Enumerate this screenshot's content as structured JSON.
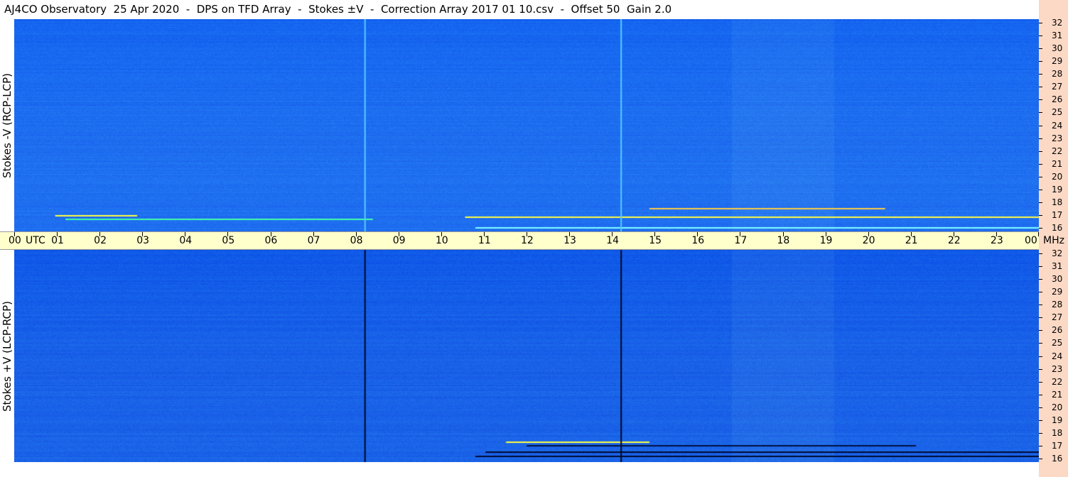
{
  "window": {
    "title": "AJ4CO Observatory  25 Apr 2020  -  DPS on TFD Array  -  Stokes ±V  -  Correction Array 2017 01 10.csv  -  Offset 50  Gain 2.0"
  },
  "chart_data": [
    {
      "type": "heatmap",
      "title": "",
      "xlabel": "UTC",
      "ylabel": "Stokes -V (RCP-LCP)",
      "x_tick_labels": [
        "00",
        "01",
        "02",
        "03",
        "04",
        "05",
        "06",
        "07",
        "08",
        "09",
        "10",
        "11",
        "12",
        "13",
        "14",
        "15",
        "16",
        "17",
        "18",
        "19",
        "20",
        "21",
        "22",
        "23",
        "00"
      ],
      "y_tick_labels": [
        "16",
        "17",
        "18",
        "19",
        "20",
        "21",
        "22",
        "23",
        "24",
        "25",
        "26",
        "27",
        "28",
        "29",
        "30",
        "31",
        "32"
      ],
      "x_unit": "UTC",
      "y_unit": "MHz",
      "xlim": [
        0,
        24
      ],
      "ylim": [
        16,
        32
      ],
      "colors": {
        "background": "#1f6ff0",
        "high": "#ffff40",
        "low": "#000022"
      },
      "vertical_lines_utc": [
        8.2,
        14.2
      ],
      "vertical_line_color": "#55ccff"
    },
    {
      "type": "heatmap",
      "title": "",
      "xlabel": "UTC",
      "ylabel": "Stokes +V (LCP-RCP)",
      "x_tick_labels": [
        "00",
        "01",
        "02",
        "03",
        "04",
        "05",
        "06",
        "07",
        "08",
        "09",
        "10",
        "11",
        "12",
        "13",
        "14",
        "15",
        "16",
        "17",
        "18",
        "19",
        "20",
        "21",
        "22",
        "23",
        "00"
      ],
      "y_tick_labels": [
        "16",
        "17",
        "18",
        "19",
        "20",
        "21",
        "22",
        "23",
        "24",
        "25",
        "26",
        "27",
        "28",
        "29",
        "30",
        "31",
        "32"
      ],
      "x_unit": "UTC",
      "y_unit": "MHz",
      "xlim": [
        0,
        24
      ],
      "ylim": [
        16,
        32
      ],
      "colors": {
        "background": "#1a63e8",
        "high": "#ffff40",
        "low": "#000018"
      },
      "vertical_lines_utc": [
        8.2,
        14.2
      ],
      "vertical_line_color": "#000820"
    }
  ],
  "axis": {
    "utc_label": "UTC",
    "mhz_label": "MHz"
  }
}
